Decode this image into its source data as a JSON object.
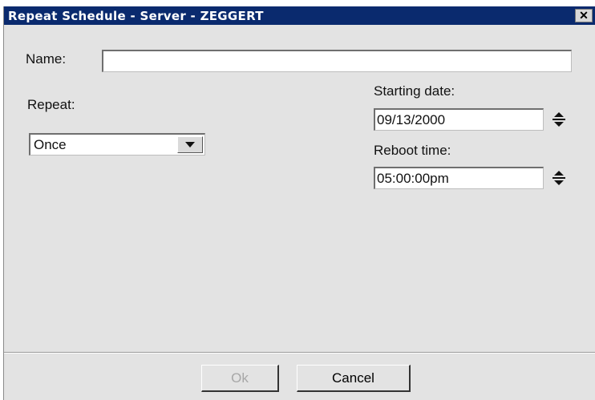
{
  "window": {
    "title": "Repeat Schedule - Server - ZEGGERT",
    "close_glyph": "✕"
  },
  "form": {
    "name_label": "Name:",
    "name_value": "",
    "repeat_label": "Repeat:",
    "repeat_value": "Once",
    "starting_date_label": "Starting date:",
    "starting_date_value": "09/13/2000",
    "reboot_time_label": "Reboot time:",
    "reboot_time_value": "05:00:00pm"
  },
  "buttons": {
    "ok_label": "Ok",
    "ok_enabled": false,
    "cancel_label": "Cancel"
  },
  "colors": {
    "titlebar": "#0a2a6e",
    "dialog_bg": "#e3e3e3"
  }
}
